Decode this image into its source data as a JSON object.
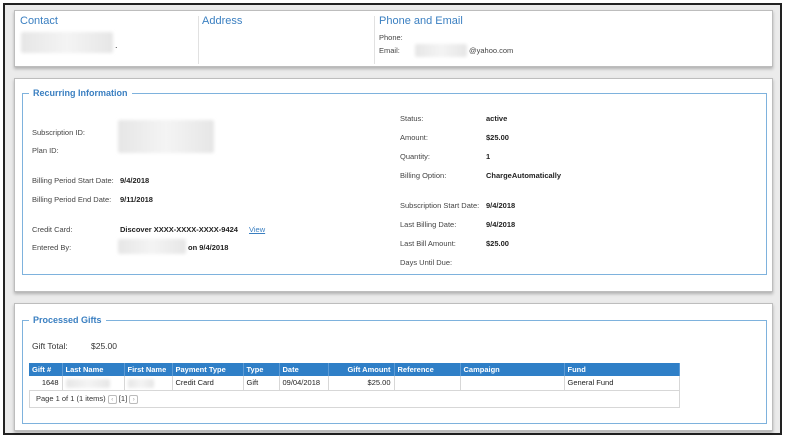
{
  "contact": {
    "heading": "Contact",
    "name_suffix": "."
  },
  "address": {
    "heading": "Address"
  },
  "phone_email": {
    "heading": "Phone and Email",
    "phone_label": "Phone:",
    "email_label": "Email:",
    "email_domain": "@yahoo.com"
  },
  "recurring": {
    "legend": "Recurring Information",
    "subscription_id_label": "Subscription ID:",
    "plan_id_label": "Plan ID:",
    "billing_start_label": "Billing Period Start Date:",
    "billing_start_value": "9/4/2018",
    "billing_end_label": "Billing Period End Date:",
    "billing_end_value": "9/11/2018",
    "credit_card_label": "Credit Card:",
    "credit_card_value": "Discover XXXX-XXXX-XXXX-9424",
    "view_link": "View",
    "entered_by_label": "Entered By:",
    "entered_by_on": "on 9/4/2018",
    "status_label": "Status:",
    "status_value": "active",
    "amount_label": "Amount:",
    "amount_value": "$25.00",
    "quantity_label": "Quantity:",
    "quantity_value": "1",
    "billing_option_label": "Billing Option:",
    "billing_option_value": "ChargeAutomatically",
    "sub_start_label": "Subscription Start Date:",
    "sub_start_value": "9/4/2018",
    "last_billing_label": "Last Billing Date:",
    "last_billing_value": "9/4/2018",
    "last_bill_amount_label": "Last Bill Amount:",
    "last_bill_amount_value": "$25.00",
    "days_until_due_label": "Days Until Due:"
  },
  "gifts": {
    "legend": "Processed Gifts",
    "total_label": "Gift Total:",
    "total_value": "$25.00",
    "columns": [
      "Gift #",
      "Last Name",
      "First Name",
      "Payment Type",
      "Type",
      "Date",
      "Gift Amount",
      "Reference",
      "Campaign",
      "Fund"
    ],
    "rows": [
      {
        "gift_no": "1648",
        "payment_type": "Credit Card",
        "type": "Gift",
        "date": "09/04/2018",
        "amount": "$25.00",
        "reference": "",
        "campaign": "",
        "fund": "General Fund"
      }
    ],
    "pager_text": "Page 1 of 1 (1 items)",
    "pager_current": "[1]",
    "prev_icon": "‹",
    "next_icon": "›"
  }
}
